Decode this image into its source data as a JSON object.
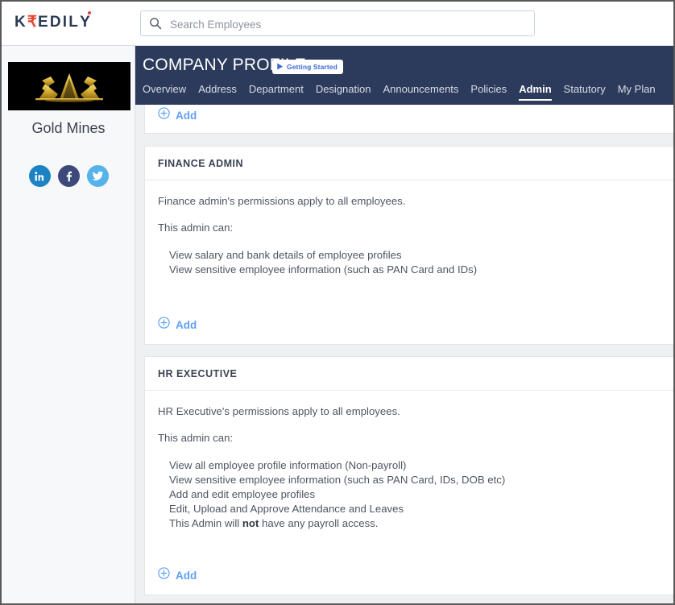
{
  "topbar": {
    "logo": {
      "pre": "K",
      "rupee": "₹",
      "post": "EDIL",
      "last": "Y"
    },
    "search": {
      "icon": "search-icon",
      "placeholder": "Search Employees",
      "value": ""
    }
  },
  "sidebar": {
    "logo_alt": "gold-mines-logo",
    "company_name": "Gold Mines",
    "social": [
      {
        "name": "linkedin-icon",
        "label": "LinkedIn",
        "color": "#1b82c4"
      },
      {
        "name": "facebook-icon",
        "label": "Facebook",
        "color": "#3b4a7a"
      },
      {
        "name": "twitter-icon",
        "label": "Twitter",
        "color": "#55b2ea"
      }
    ]
  },
  "header": {
    "title": "COMPANY PROFILE",
    "getting_started": {
      "label": "Getting Started",
      "icon": "play-icon",
      "color": "#3d6ad6"
    },
    "tabs": [
      {
        "label": "Overview",
        "active": false
      },
      {
        "label": "Address",
        "active": false
      },
      {
        "label": "Department",
        "active": false
      },
      {
        "label": "Designation",
        "active": false
      },
      {
        "label": "Announcements",
        "active": false
      },
      {
        "label": "Policies",
        "active": false
      },
      {
        "label": "Admin",
        "active": true
      },
      {
        "label": "Statutory",
        "active": false
      },
      {
        "label": "My Plan",
        "active": false
      }
    ],
    "bg_color": "#2c3a5c"
  },
  "main": {
    "top_add": {
      "label": "Add",
      "icon": "plus-circle-icon"
    },
    "cards": [
      {
        "title": "FINANCE ADMIN",
        "intro": "Finance admin's permissions apply to all employees.",
        "subintro": "This admin can:",
        "permissions": [
          "View salary and bank details of employee profiles",
          "View sensitive employee information (such as PAN Card and IDs)"
        ],
        "add": {
          "label": "Add",
          "icon": "plus-circle-icon"
        }
      },
      {
        "title": "HR EXECUTIVE",
        "intro": "HR Executive's permissions apply to all employees.",
        "subintro": "This admin can:",
        "permissions": [
          "View all employee profile information (Non-payroll)",
          "View sensitive employee information (such as PAN Card, IDs, DOB etc)",
          "Add and edit employee profiles",
          "Edit, Upload and Approve Attendance and Leaves"
        ],
        "permission_last_pre": "This Admin will ",
        "permission_last_bold": "not",
        "permission_last_post": " have any payroll access.",
        "add": {
          "label": "Add",
          "icon": "plus-circle-icon"
        }
      }
    ]
  },
  "colors": {
    "accent_blue": "#5fa0f5",
    "header_navy": "#2c3a5c",
    "logo_red": "#e8412c",
    "page_bg": "#eef0f2"
  }
}
